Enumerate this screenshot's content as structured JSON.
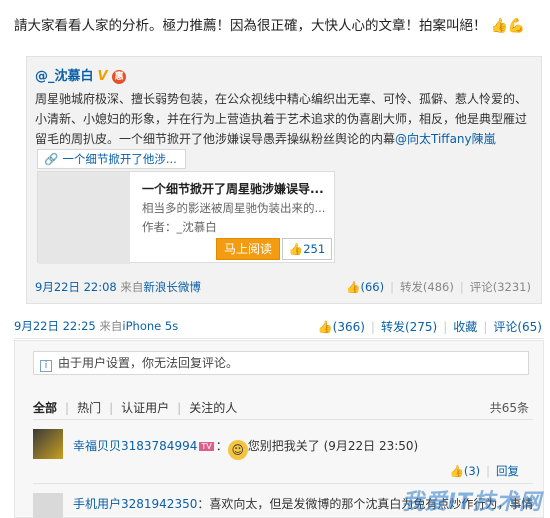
{
  "post": {
    "text": "請大家看看人家的分析。極力推薦！因為很正確，大快人心的文章！拍案叫絕！",
    "emoji_icons": "thumbs-up-icon, flex-arm-icon"
  },
  "repost": {
    "author": "@_沈慕白",
    "v_badge": "V",
    "vip_badge": "惠",
    "text_main": "周星驰城府极深、擅长弱势包装，在公众视线中精心编织出无辜、可怜、孤僻、惹人怜爱的、小清新、小媳妇的形象，并在行为上营造执着于艺术追求的伪喜剧大师，相反，他是典型雁过留毛的周扒皮。一个细节掀开了他涉嫌误导愚弄操纵粉丝舆论的内幕",
    "mention": "@向太Tiffany陳嵐",
    "link_chip": "一个细节掀开了他涉...",
    "card": {
      "title": "一个细节掀开了周星驰涉嫌误导...",
      "desc": "相当多的影迷被周星驰伪装出来的...",
      "author": "作者：_沈慕白",
      "read_button": "马上阅读",
      "like_count": "251"
    },
    "time": "9月22日 22:08",
    "source_prefix": "来自",
    "source": "新浪长微博",
    "likes": "(66)",
    "reposts": "转发(486)",
    "comments": "评论(3231)"
  },
  "main_post_meta": {
    "time": "9月22日 22:25",
    "source_prefix": "来自",
    "source": "iPhone 5s",
    "likes": "(366)",
    "reposts": "转发(275)",
    "favorite": "收藏",
    "comments": "评论(65)"
  },
  "comments_panel": {
    "notice": "由于用户设置，你无法回复评论。",
    "filters": [
      "全部",
      "热门",
      "认证用户",
      "关注的人"
    ],
    "total": "共65条",
    "items": [
      {
        "user": "幸福贝贝3183784994",
        "badge": "TV",
        "text": "您别把我关了",
        "time": "(9月22日 23:50)",
        "likes": "(3)",
        "reply": "回复"
      },
      {
        "user": "手机用户3281942350",
        "text": "：喜欢向太，但是发微博的那个沈真白为免有点炒作行为，事情都过"
      }
    ]
  },
  "watermark": "我爱IT技术网"
}
